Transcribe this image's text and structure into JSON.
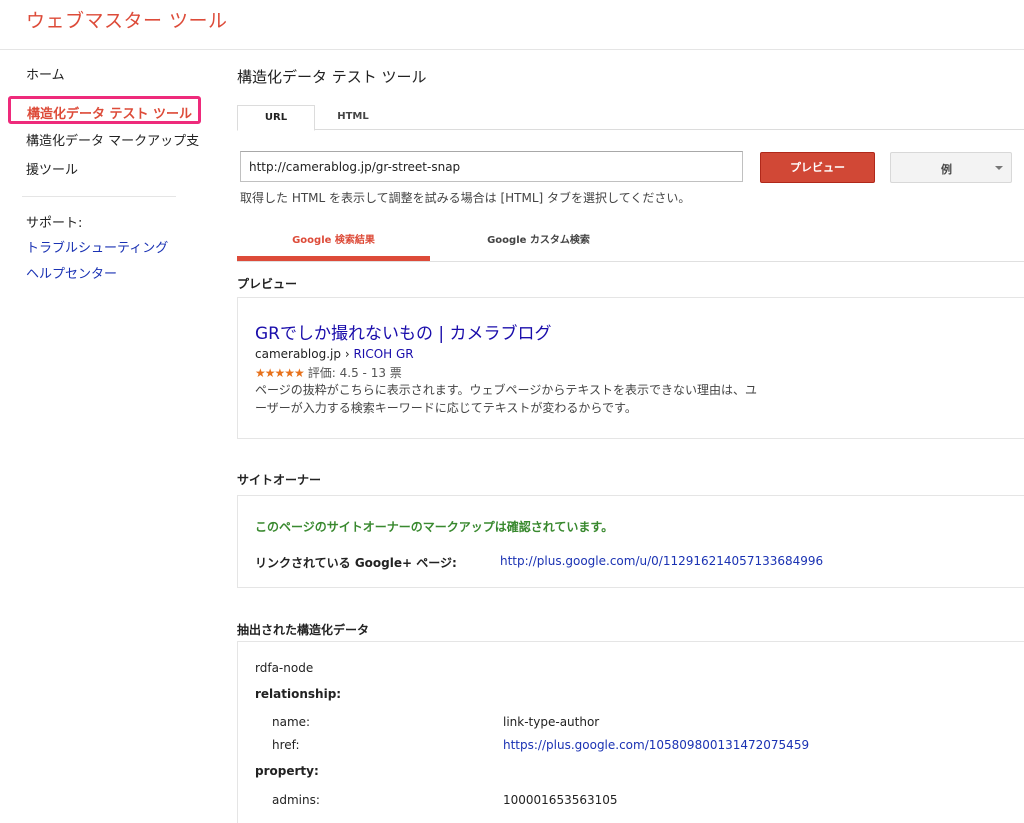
{
  "app": {
    "title": "ウェブマスター ツール"
  },
  "sidebar": {
    "home": "ホーム",
    "active_item": "構造化データ テスト ツール",
    "markup_helper_line1": "構造化データ マークアップ支",
    "markup_helper_line2": "援ツール",
    "support_label": "サポート:",
    "support_links": [
      "トラブルシューティング",
      "ヘルプセンター"
    ]
  },
  "main": {
    "page_title": "構造化データ テスト ツール",
    "tabs": [
      {
        "label": "URL",
        "active": true
      },
      {
        "label": "HTML",
        "active": false
      }
    ],
    "url_input": {
      "value": "http://camerablog.jp/gr-street-snap"
    },
    "preview_button": "プレビュー",
    "example_select": "例",
    "helper_text": "取得した HTML を表示して調整を試みる場合は [HTML] タブを選択してください。",
    "sub_tabs": [
      {
        "label": "Google 検索結果",
        "active": true
      },
      {
        "label": "Google カスタム検索",
        "active": false
      }
    ],
    "preview": {
      "heading": "プレビュー",
      "result_title": "GRでしか撮れないもの | カメラブログ",
      "result_domain": "camerablog.jp",
      "result_sep": " › ",
      "result_crumb_link": "RICOH GR",
      "stars": "★★★★★",
      "rating_text": "評価: 4.5 - 13 票",
      "snippet_line1": "ページの抜粋がこちらに表示されます。ウェブページからテキストを表示できない理由は、ユ",
      "snippet_line2": "ーザーが入力する検索キーワードに応じてテキストが変わるからです。"
    },
    "site_owner": {
      "heading": "サイトオーナー",
      "confirmation": "このページのサイトオーナーのマークアップは確認されています。",
      "linked_label": "リンクされている Google+ ページ:",
      "linked_url": "http://plus.google.com/u/0/112916214057133684996"
    },
    "structured_data": {
      "heading": "抽出された構造化データ",
      "node": "rdfa-node",
      "relationship_label": "relationship:",
      "relationship": [
        {
          "key": "name:",
          "value": "link-type-author",
          "link": false
        },
        {
          "key": "href:",
          "value": "https://plus.google.com/105809800131472075459",
          "link": true
        }
      ],
      "property_label": "property:",
      "property": [
        {
          "key": "admins:",
          "value": "100001653563105",
          "link": false
        }
      ]
    }
  },
  "colors": {
    "brand_red": "#dd4b39",
    "highlight_pink": "#ee2a7b",
    "link_blue": "#1a0dab",
    "confirm_green": "#39892f",
    "star_orange": "#e7711b"
  }
}
